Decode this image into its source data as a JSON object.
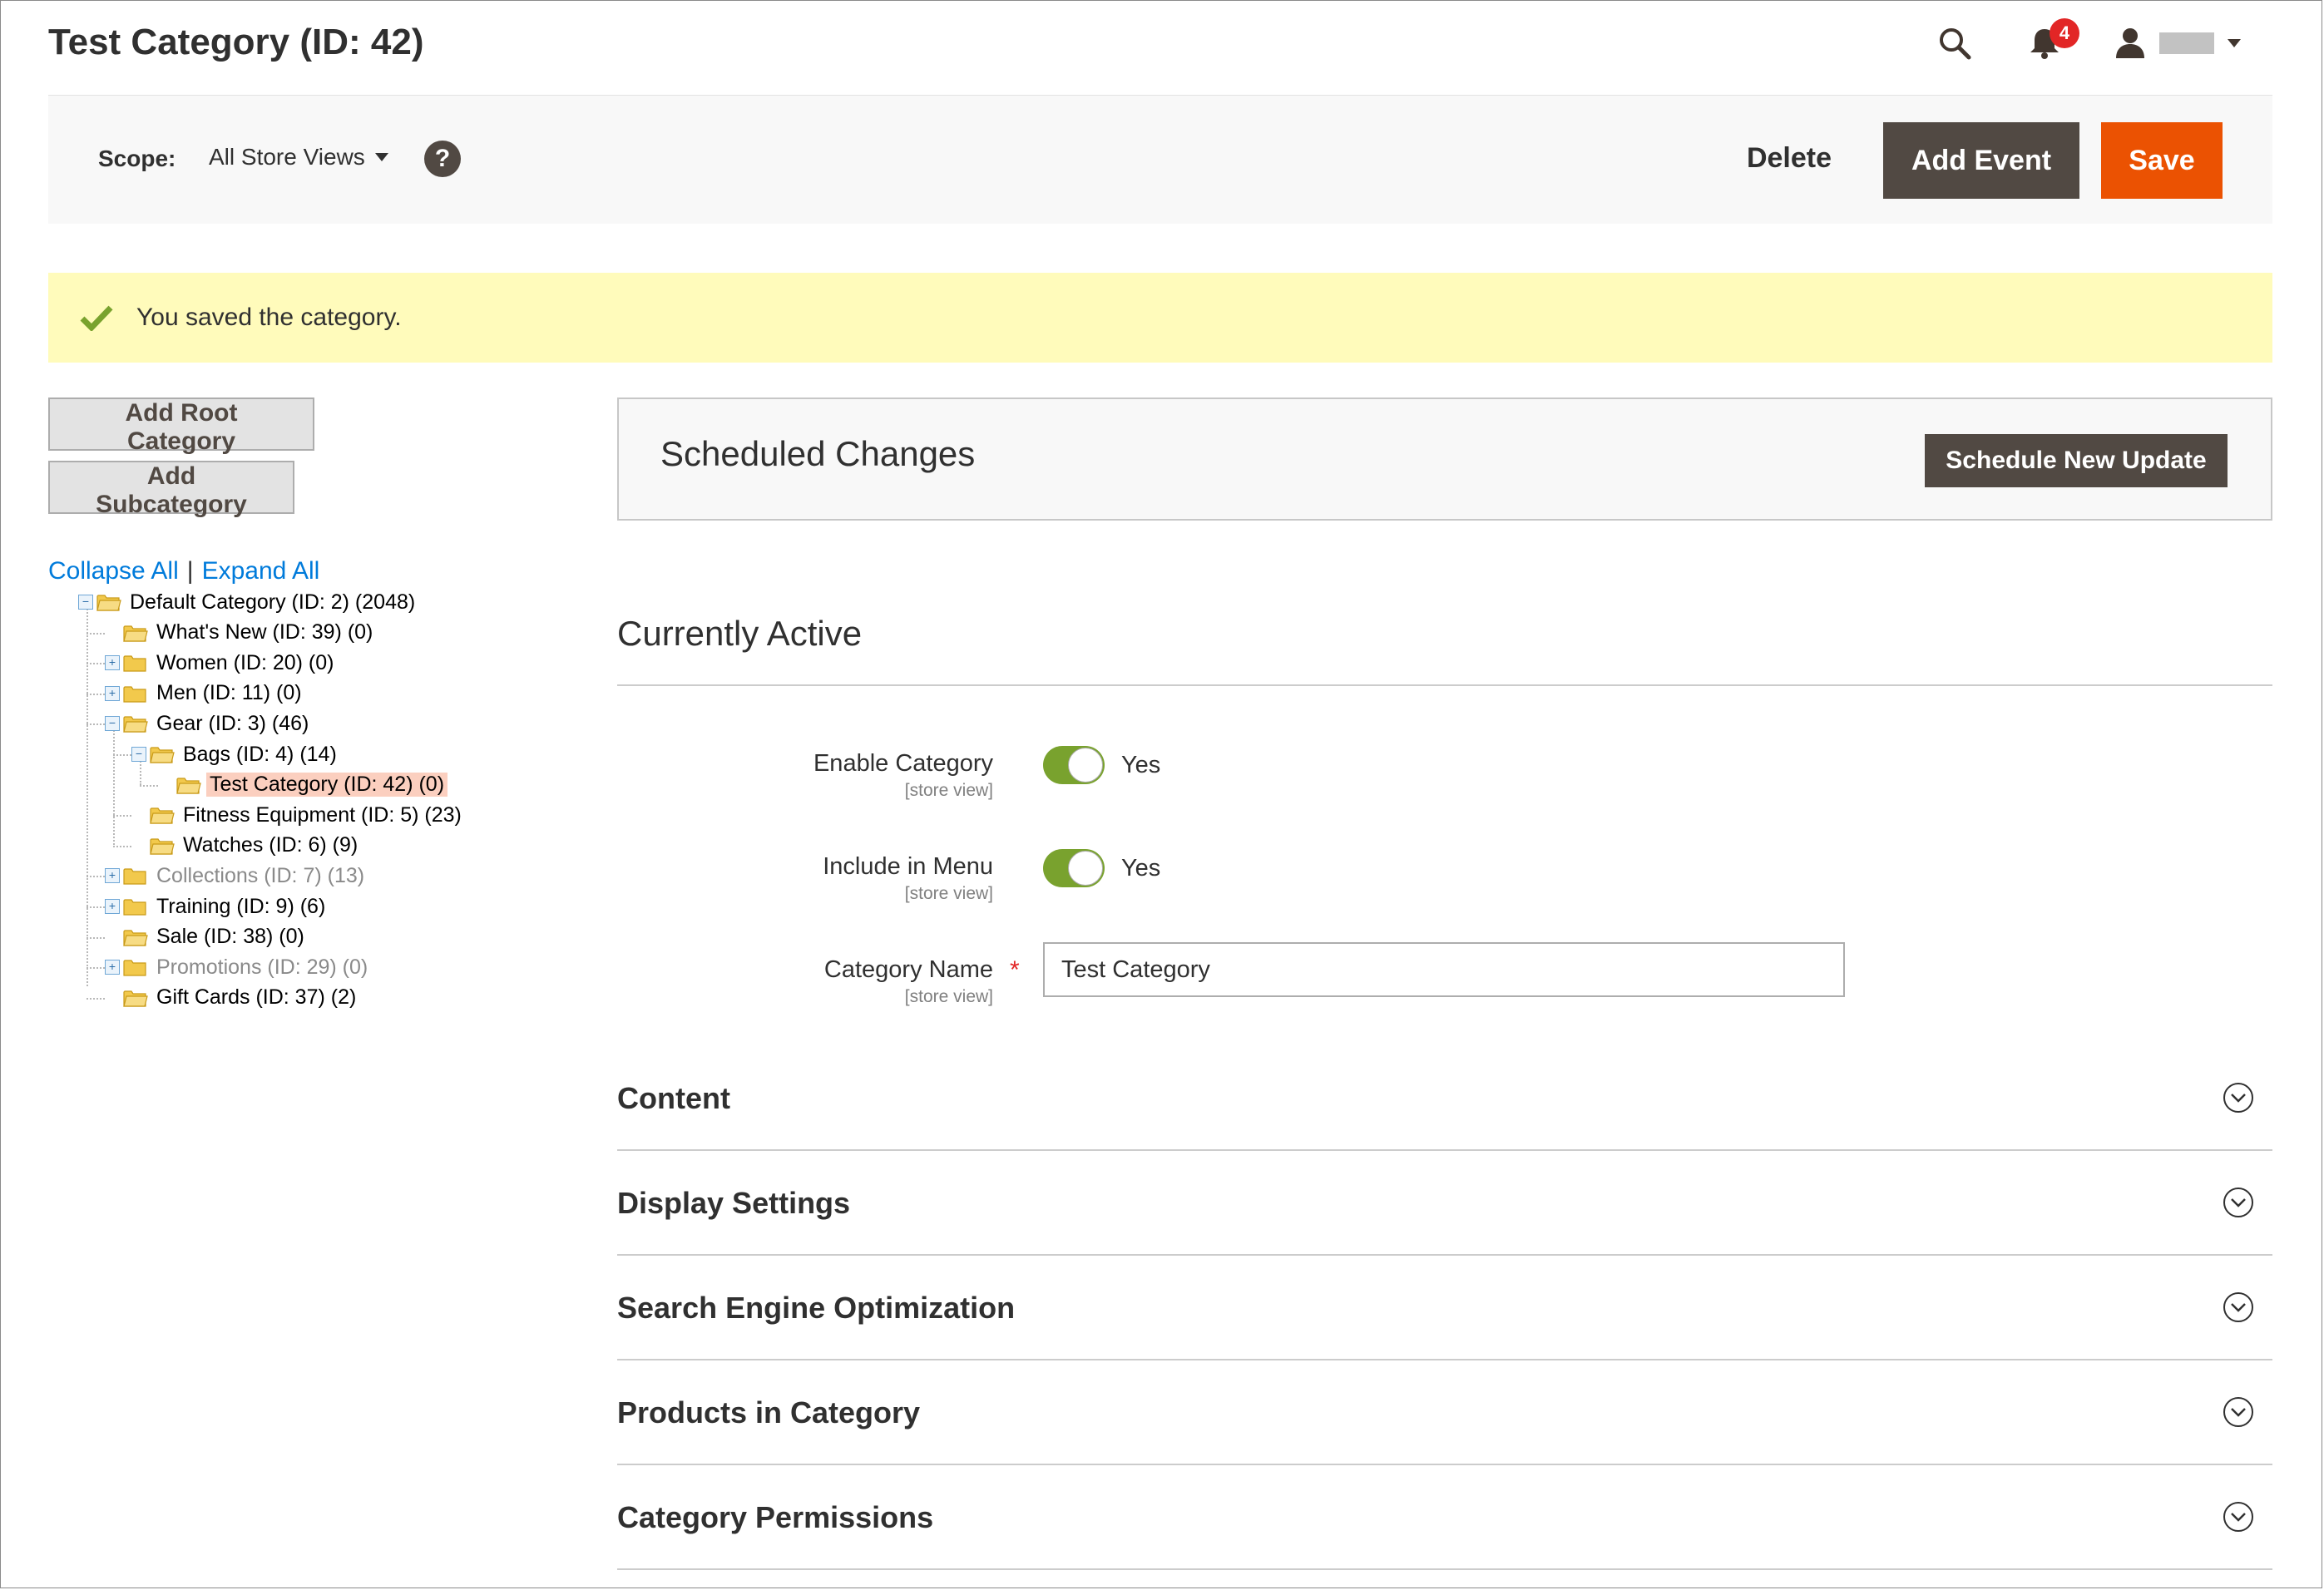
{
  "header": {
    "title": "Test Category (ID: 42)",
    "notifications_count": "4",
    "icons": [
      "search-icon",
      "bell-icon",
      "user-icon",
      "caret-down-icon"
    ]
  },
  "page_actions": {
    "scope_label": "Scope:",
    "scope_value": "All Store Views",
    "help": "?",
    "delete_label": "Delete",
    "add_event_label": "Add Event",
    "save_label": "Save"
  },
  "message": {
    "text": "You saved the category."
  },
  "tree_panel": {
    "add_root_label": "Add Root Category",
    "add_sub_label": "Add Subcategory",
    "collapse_all": "Collapse All",
    "separator": "|",
    "expand_all": "Expand All",
    "nodes": [
      {
        "label": "Default Category (ID: 2) (2048)",
        "depth": 0,
        "expander": "minus",
        "disabled": false,
        "selected": false
      },
      {
        "label": "What's New (ID: 39) (0)",
        "depth": 1,
        "expander": "none",
        "disabled": false,
        "selected": false
      },
      {
        "label": "Women (ID: 20) (0)",
        "depth": 1,
        "expander": "plus",
        "disabled": false,
        "selected": false
      },
      {
        "label": "Men (ID: 11) (0)",
        "depth": 1,
        "expander": "plus",
        "disabled": false,
        "selected": false
      },
      {
        "label": "Gear (ID: 3) (46)",
        "depth": 1,
        "expander": "minus",
        "disabled": false,
        "selected": false
      },
      {
        "label": "Bags (ID: 4) (14)",
        "depth": 2,
        "expander": "minus",
        "disabled": false,
        "selected": false
      },
      {
        "label": "Test Category (ID: 42) (0)",
        "depth": 3,
        "expander": "none",
        "disabled": false,
        "selected": true
      },
      {
        "label": "Fitness Equipment (ID: 5) (23)",
        "depth": 2,
        "expander": "none",
        "disabled": false,
        "selected": false
      },
      {
        "label": "Watches (ID: 6) (9)",
        "depth": 2,
        "expander": "none",
        "disabled": false,
        "selected": false
      },
      {
        "label": "Collections (ID: 7) (13)",
        "depth": 1,
        "expander": "plus",
        "disabled": true,
        "selected": false
      },
      {
        "label": "Training (ID: 9) (6)",
        "depth": 1,
        "expander": "plus",
        "disabled": false,
        "selected": false
      },
      {
        "label": "Sale (ID: 38) (0)",
        "depth": 1,
        "expander": "none",
        "disabled": false,
        "selected": false
      },
      {
        "label": "Promotions (ID: 29) (0)",
        "depth": 1,
        "expander": "plus",
        "disabled": true,
        "selected": false
      },
      {
        "label": "Gift Cards (ID: 37) (2)",
        "depth": 1,
        "expander": "none",
        "disabled": false,
        "selected": false
      }
    ]
  },
  "staging": {
    "title": "Scheduled Changes",
    "schedule_button": "Schedule New Update"
  },
  "form": {
    "section_title": "Currently Active",
    "enable_category": {
      "label": "Enable Category",
      "scope": "[store view]",
      "value_text": "Yes",
      "on": true
    },
    "include_in_menu": {
      "label": "Include in Menu",
      "scope": "[store view]",
      "value_text": "Yes",
      "on": true
    },
    "category_name": {
      "label": "Category Name",
      "scope": "[store view]",
      "required": "*",
      "value": "Test Category"
    }
  },
  "sections": [
    {
      "title": "Content",
      "icon": "chevron-down-circle-icon"
    },
    {
      "title": "Display Settings",
      "icon": "chevron-down-circle-icon"
    },
    {
      "title": "Search Engine Optimization",
      "icon": "chevron-down-circle-icon"
    },
    {
      "title": "Products in Category",
      "icon": "chevron-down-circle-icon"
    },
    {
      "title": "Category Permissions",
      "icon": "chevron-down-circle-icon"
    }
  ],
  "colors": {
    "primary_button": "#eb5202",
    "secondary_button": "#514943",
    "success_bg": "#fffbbb",
    "success_check": "#79a22e",
    "link": "#007bdb",
    "toggle_on": "#79a22e",
    "selected_node": "#fbcfbf",
    "badge": "#e22626"
  }
}
